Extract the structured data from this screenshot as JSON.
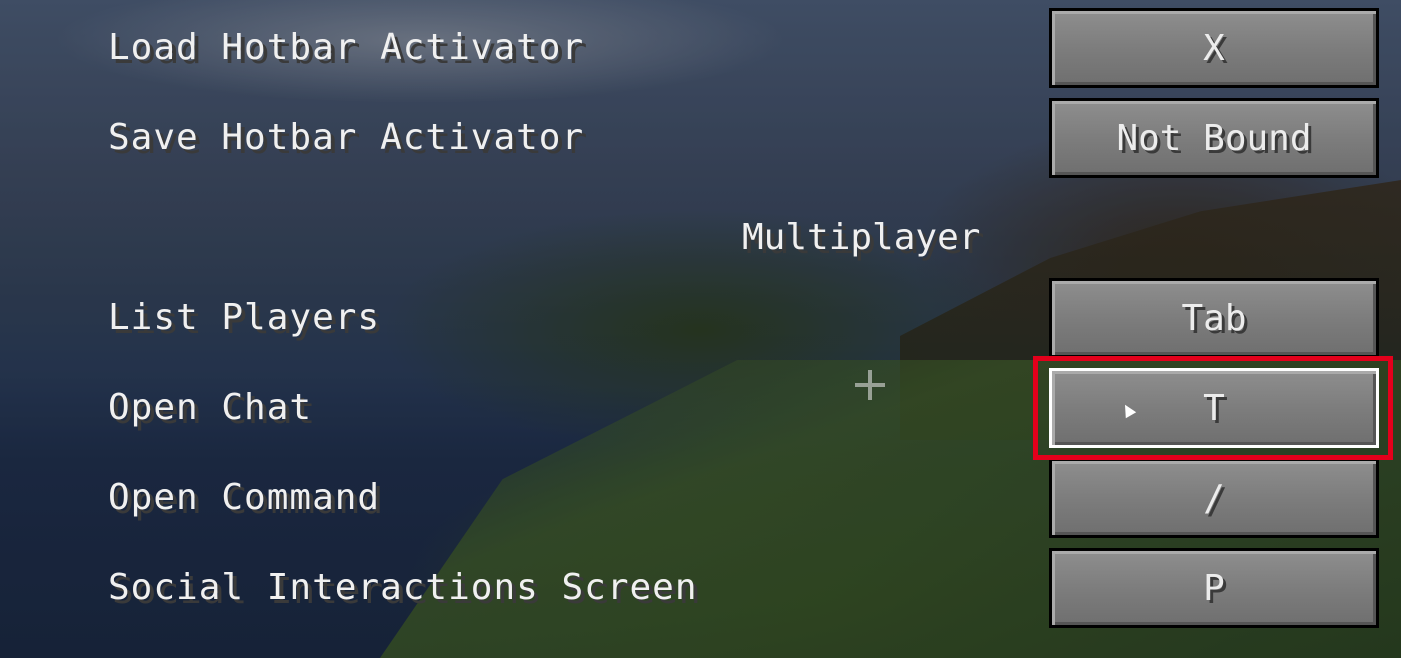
{
  "sections": [
    {
      "title": "",
      "bindings": [
        {
          "label": "Load Hotbar Activator",
          "key": "X"
        },
        {
          "label": "Save Hotbar Activator",
          "key": "Not Bound"
        }
      ]
    },
    {
      "title": "Multiplayer",
      "bindings": [
        {
          "label": "List Players",
          "key": "Tab"
        },
        {
          "label": "Open Chat",
          "key": "T"
        },
        {
          "label": "Open Command",
          "key": "/"
        },
        {
          "label": "Social Interactions Screen",
          "key": "P"
        }
      ]
    }
  ],
  "highlight_color": "#e3001b",
  "icons": [
    "mouse-cursor-icon",
    "crosshair-icon"
  ]
}
